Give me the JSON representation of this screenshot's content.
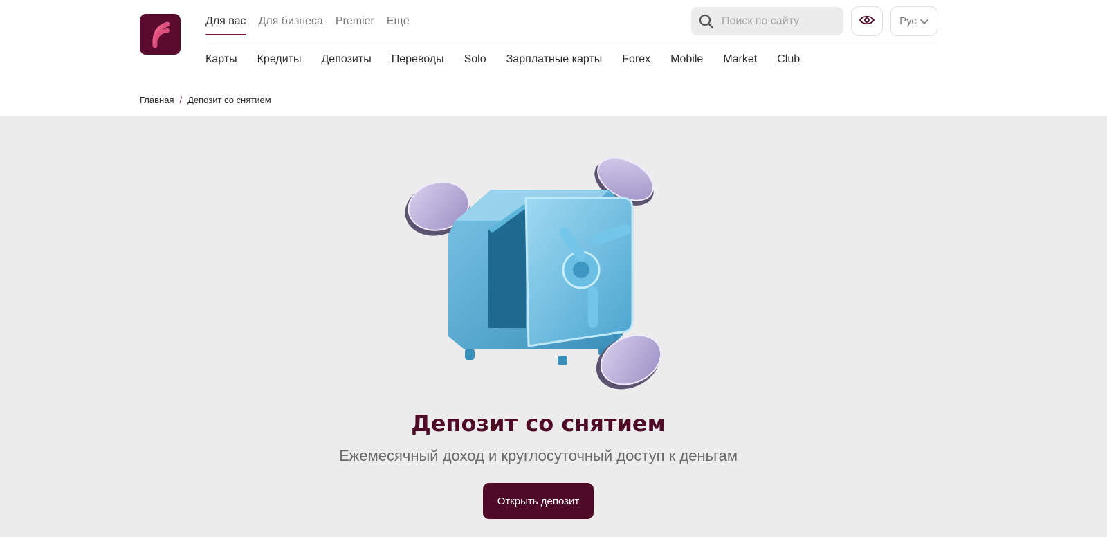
{
  "logo": {
    "icon": "bank-logo-icon",
    "color": "#5a0a2c"
  },
  "top_tabs": [
    {
      "label": "Для вас",
      "active": true
    },
    {
      "label": "Для бизнеса",
      "active": false
    },
    {
      "label": "Premier",
      "active": false
    },
    {
      "label": "Ещё",
      "active": false
    }
  ],
  "search": {
    "placeholder": "Поиск по сайту",
    "value": "",
    "icon": "search-icon"
  },
  "accessibility_button": {
    "icon": "eye-icon"
  },
  "language": {
    "selected": "Рус",
    "icon": "chevron-down-icon"
  },
  "main_nav": [
    "Карты",
    "Кредиты",
    "Депозиты",
    "Переводы",
    "Solo",
    "Зарплатные карты",
    "Forex",
    "Mobile",
    "Market",
    "Club"
  ],
  "breadcrumb": {
    "home": "Главная",
    "separator": "/",
    "current": "Депозит со снятием"
  },
  "hero": {
    "illustration": "safe-with-coins-illustration",
    "title": "Депозит со снятием",
    "subtitle": "Ежемесячный доход и круглосуточный доступ к деньгам",
    "cta_label": "Открыть депозит"
  },
  "colors": {
    "brand": "#5a0a2c",
    "title": "#4e0a26",
    "accent_underline": "#7a1940",
    "hero_background": "#ececec"
  }
}
